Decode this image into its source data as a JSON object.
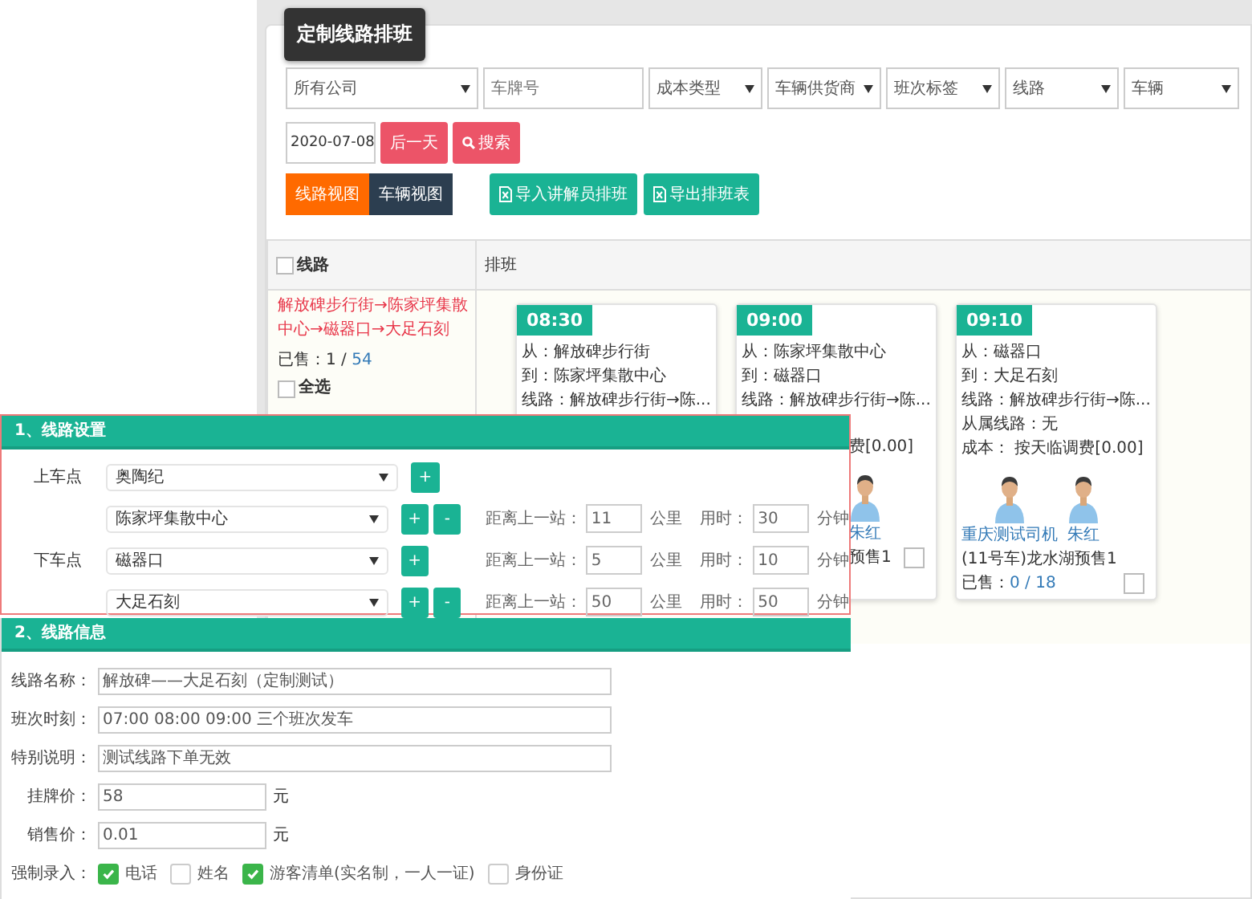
{
  "page_title": "定制线路排班",
  "filters": [
    {
      "kind": "select",
      "label": "所有公司"
    },
    {
      "kind": "input",
      "placeholder": "车牌号"
    },
    {
      "kind": "select",
      "label": "成本类型"
    },
    {
      "kind": "select",
      "label": "车辆供货商"
    },
    {
      "kind": "select",
      "label": "班次标签"
    },
    {
      "kind": "select",
      "label": "线路"
    },
    {
      "kind": "select",
      "label": "车辆"
    }
  ],
  "date": "2020-07-08",
  "next_day_button": "后一天",
  "search_button": "搜索",
  "view_tabs": [
    {
      "label": "线路视图",
      "selected": true
    },
    {
      "label": "车辆视图",
      "selected": false
    }
  ],
  "action_buttons": [
    "导入讲解员排班",
    "导出排班表"
  ],
  "table": {
    "columns": [
      "线路",
      "排班"
    ],
    "header_checked": false,
    "route": {
      "name": "解放碑步行街→陈家坪集散中心→磁器口→大足石刻",
      "sold_label": "已售：",
      "sold": "1",
      "separator": "/",
      "total": "54",
      "select_all": "全选",
      "select_all_checked": false
    },
    "cards": [
      {
        "kind": "clipped",
        "time": "08:30",
        "lines": [
          "从：解放碑步行街",
          "到：陈家坪集散中心",
          "线路：解放碑步行街→陈..."
        ]
      },
      {
        "kind": "clipped",
        "time": "09:00",
        "lines": [
          "从：陈家坪集散中心",
          "到：磁器口",
          "线路：解放碑步行街→陈..."
        ],
        "details": [
          "费[0.00]"
        ],
        "drivers": [
          "朱红"
        ],
        "vehicle": "预售1",
        "checked": false
      },
      {
        "kind": "full",
        "time": "09:10",
        "lines": [
          "从：磁器口",
          "到：大足石刻",
          "线路：解放碑步行街→陈..."
        ],
        "details": [
          "从属线路：无",
          "成本：  按天临调费[0.00]"
        ],
        "drivers": [
          "重庆测试司机",
          "朱红"
        ],
        "vehicle": "(11号车)龙水湖预售1",
        "sold_label": "已售：",
        "sold": "0",
        "separator": "/",
        "total": "18",
        "checked": false
      }
    ]
  },
  "route_settings": {
    "title": "1、线路设置",
    "rows": [
      {
        "label": "上车点",
        "stop": "奥陶纪",
        "add": "+"
      },
      {
        "label": "",
        "stop": "陈家坪集散中心",
        "add": "+",
        "remove": "-",
        "distance_label": "距离上一站：",
        "distance": "11",
        "km_unit": "公里",
        "time_label": "用时：",
        "minutes": "30",
        "minute_unit": "分钟"
      },
      {
        "label": "下车点",
        "stop": "磁器口",
        "add": "+",
        "distance_label": "距离上一站：",
        "distance": "5",
        "km_unit": "公里",
        "time_label": "用时：",
        "minutes": "10",
        "minute_unit": "分钟"
      },
      {
        "label": "",
        "stop": "大足石刻",
        "add": "+",
        "remove": "-",
        "distance_label": "距离上一站：",
        "distance": "50",
        "km_unit": "公里",
        "time_label": "用时：",
        "minutes": "50",
        "minute_unit": "分钟"
      }
    ]
  },
  "route_info": {
    "title": "2、线路信息",
    "fields": [
      {
        "kind": "wide",
        "label": "线路名称：",
        "value": "解放碑——大足石刻（定制测试）"
      },
      {
        "kind": "wide",
        "label": "班次时刻：",
        "value": "07:00 08:00 09:00 三个班次发车"
      },
      {
        "kind": "wide",
        "label": "特别说明：",
        "value": "测试线路下单无效"
      },
      {
        "kind": "price",
        "label": "挂牌价：",
        "value": "58",
        "unit": "元"
      },
      {
        "kind": "price",
        "label": "销售价：",
        "value": "0.01",
        "unit": "元"
      }
    ],
    "required_label": "强制录入：",
    "required": [
      {
        "label": "电话",
        "checked": true
      },
      {
        "label": "姓名",
        "checked": false
      },
      {
        "label": "游客清单(实名制，一人一证)",
        "checked": true
      },
      {
        "label": "身份证",
        "checked": false
      }
    ]
  }
}
